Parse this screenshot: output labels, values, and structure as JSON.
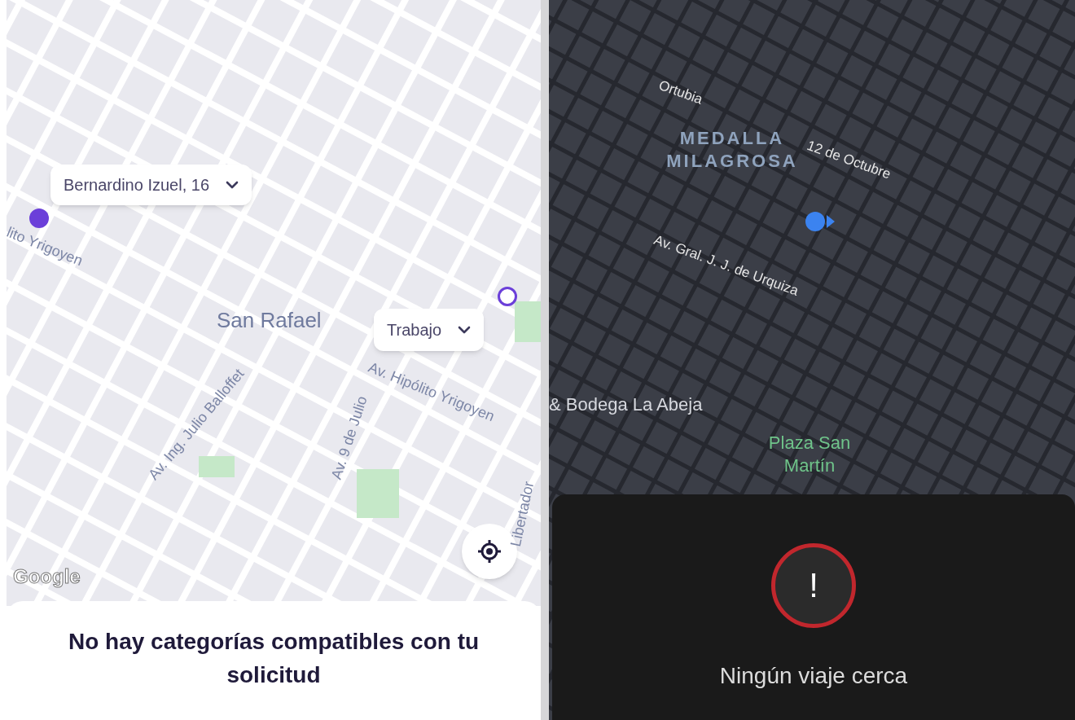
{
  "left_screen": {
    "pickup": {
      "label": "Bernardino Izuel, 16"
    },
    "destination": {
      "label": "Trabajo"
    },
    "map_labels": [
      {
        "text": "lito Yrigoyen",
        "kind": "street"
      },
      {
        "text": "San Rafael",
        "kind": "area"
      },
      {
        "text": "Av. Hipólito Yrigoyen",
        "kind": "street"
      },
      {
        "text": "Av. Ing. Julio Balloffet",
        "kind": "street"
      },
      {
        "text": "Av. 9 de Julio",
        "kind": "street"
      },
      {
        "text": "Libertador",
        "kind": "street"
      }
    ],
    "attribution": "Google",
    "message": "No hay categorías compatibles con tu solicitud"
  },
  "right_screen": {
    "map_labels": [
      {
        "text": "Ortubia",
        "kind": "street"
      },
      {
        "text": "MEDALLA MILAGROSA",
        "kind": "area"
      },
      {
        "text": "12 de Octubre",
        "kind": "street"
      },
      {
        "text": "Av. Gral. J. J. de Urquiza",
        "kind": "street"
      },
      {
        "text": "& Bodega La Abeja",
        "kind": "place"
      },
      {
        "text": "Plaza San Martín",
        "kind": "park"
      }
    ],
    "alert_glyph": "!",
    "message": "Ningún viaje cerca"
  }
}
